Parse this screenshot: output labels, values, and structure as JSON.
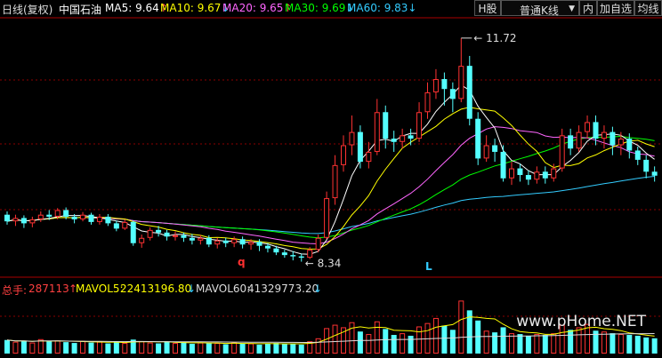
{
  "header": {
    "period": "日线(复权)",
    "stock_name": "中国石油",
    "ma": [
      {
        "label": "MA5: ",
        "value": "9.64",
        "arrow": "↑",
        "color": "#ffffff"
      },
      {
        "label": "MA10: ",
        "value": "9.67",
        "arrow": "↓",
        "color": "#ffff00"
      },
      {
        "label": "MA20: ",
        "value": "9.65",
        "arrow": "↑",
        "color": "#ff66ff"
      },
      {
        "label": "MA30: ",
        "value": "9.69",
        "arrow": "↓",
        "color": "#00ff00"
      },
      {
        "label": "MA60: ",
        "value": "9.83",
        "arrow": "↓",
        "color": "#33ccff"
      }
    ],
    "buttons": {
      "h_share": "H股",
      "kline_type": "普通K线",
      "kline_arrow": "▼",
      "inner": "内",
      "add_watch": "加自选",
      "ma_line": "均线"
    }
  },
  "annotations": {
    "high_label": "11.72",
    "low_label": "8.34",
    "mark_q": "q",
    "mark_L": "L"
  },
  "volume_header": {
    "total_label": "总手: ",
    "total_value": "287113",
    "total_arrow": "↑",
    "mavol5_label": "MAVOL5: ",
    "mavol5_value": "22413196.80",
    "mavol5_arrow": "↓",
    "mavol60_label": "MAVOL60: ",
    "mavol60_value": "41329773.20",
    "mavol60_arrow": "↓"
  },
  "watermark": "www.pHome.NET",
  "colors": {
    "up": "#ff3232",
    "down": "#54ffff",
    "ma5": "#ffffff",
    "ma10": "#ffff00",
    "ma20": "#ff66ff",
    "ma30": "#00ff00",
    "ma60": "#33ccff",
    "grid": "#8b0000"
  },
  "chart_data": {
    "type": "candlestick",
    "title": "中国石油",
    "price_range": [
      8.2,
      12.0
    ],
    "high": 11.72,
    "low": 8.34,
    "candles": [
      {
        "o": 9.05,
        "c": 8.95,
        "h": 9.1,
        "l": 8.9
      },
      {
        "o": 8.95,
        "c": 9.0,
        "h": 9.05,
        "l": 8.88
      },
      {
        "o": 9.0,
        "c": 8.92,
        "h": 9.04,
        "l": 8.85
      },
      {
        "o": 8.92,
        "c": 8.98,
        "h": 9.02,
        "l": 8.86
      },
      {
        "o": 8.98,
        "c": 9.05,
        "h": 9.1,
        "l": 8.94
      },
      {
        "o": 9.05,
        "c": 9.02,
        "h": 9.12,
        "l": 8.97
      },
      {
        "o": 9.02,
        "c": 9.12,
        "h": 9.15,
        "l": 8.98
      },
      {
        "o": 9.12,
        "c": 9.02,
        "h": 9.16,
        "l": 8.98
      },
      {
        "o": 9.02,
        "c": 8.98,
        "h": 9.06,
        "l": 8.92
      },
      {
        "o": 8.98,
        "c": 9.05,
        "h": 9.09,
        "l": 8.95
      },
      {
        "o": 9.05,
        "c": 8.94,
        "h": 9.08,
        "l": 8.9
      },
      {
        "o": 8.94,
        "c": 9.02,
        "h": 9.06,
        "l": 8.9
      },
      {
        "o": 9.02,
        "c": 8.92,
        "h": 9.06,
        "l": 8.88
      },
      {
        "o": 8.92,
        "c": 8.84,
        "h": 8.96,
        "l": 8.8
      },
      {
        "o": 8.84,
        "c": 8.94,
        "h": 8.98,
        "l": 8.82
      },
      {
        "o": 8.94,
        "c": 8.62,
        "h": 8.96,
        "l": 8.58
      },
      {
        "o": 8.62,
        "c": 8.7,
        "h": 8.75,
        "l": 8.55
      },
      {
        "o": 8.7,
        "c": 8.82,
        "h": 8.86,
        "l": 8.66
      },
      {
        "o": 8.82,
        "c": 8.78,
        "h": 8.88,
        "l": 8.72
      },
      {
        "o": 8.78,
        "c": 8.72,
        "h": 8.82,
        "l": 8.66
      },
      {
        "o": 8.72,
        "c": 8.74,
        "h": 8.8,
        "l": 8.66
      },
      {
        "o": 8.74,
        "c": 8.7,
        "h": 8.78,
        "l": 8.64
      },
      {
        "o": 8.7,
        "c": 8.66,
        "h": 8.76,
        "l": 8.6
      },
      {
        "o": 8.66,
        "c": 8.7,
        "h": 8.74,
        "l": 8.6
      },
      {
        "o": 8.7,
        "c": 8.6,
        "h": 8.74,
        "l": 8.56
      },
      {
        "o": 8.6,
        "c": 8.66,
        "h": 8.7,
        "l": 8.54
      },
      {
        "o": 8.66,
        "c": 8.62,
        "h": 8.7,
        "l": 8.56
      },
      {
        "o": 8.62,
        "c": 8.68,
        "h": 8.72,
        "l": 8.56
      },
      {
        "o": 8.68,
        "c": 8.6,
        "h": 8.72,
        "l": 8.54
      },
      {
        "o": 8.6,
        "c": 8.64,
        "h": 8.68,
        "l": 8.52
      },
      {
        "o": 8.64,
        "c": 8.58,
        "h": 8.68,
        "l": 8.5
      },
      {
        "o": 8.58,
        "c": 8.54,
        "h": 8.62,
        "l": 8.48
      },
      {
        "o": 8.54,
        "c": 8.48,
        "h": 8.58,
        "l": 8.44
      },
      {
        "o": 8.48,
        "c": 8.44,
        "h": 8.52,
        "l": 8.4
      },
      {
        "o": 8.44,
        "c": 8.42,
        "h": 8.5,
        "l": 8.36
      },
      {
        "o": 8.42,
        "c": 8.4,
        "h": 8.46,
        "l": 8.34
      },
      {
        "o": 8.4,
        "c": 8.52,
        "h": 8.56,
        "l": 8.38
      },
      {
        "o": 8.52,
        "c": 8.7,
        "h": 8.75,
        "l": 8.48
      },
      {
        "o": 8.7,
        "c": 9.3,
        "h": 9.4,
        "l": 8.68
      },
      {
        "o": 9.3,
        "c": 9.8,
        "h": 9.95,
        "l": 9.2
      },
      {
        "o": 9.8,
        "c": 10.1,
        "h": 10.25,
        "l": 9.7
      },
      {
        "o": 10.1,
        "c": 10.3,
        "h": 10.55,
        "l": 9.95
      },
      {
        "o": 10.3,
        "c": 9.85,
        "h": 10.4,
        "l": 9.75
      },
      {
        "o": 9.85,
        "c": 10.0,
        "h": 10.15,
        "l": 9.75
      },
      {
        "o": 10.0,
        "c": 10.6,
        "h": 10.8,
        "l": 9.95
      },
      {
        "o": 10.6,
        "c": 10.2,
        "h": 10.7,
        "l": 10.05
      },
      {
        "o": 10.2,
        "c": 10.15,
        "h": 10.32,
        "l": 10.0
      },
      {
        "o": 10.15,
        "c": 10.25,
        "h": 10.35,
        "l": 10.05
      },
      {
        "o": 10.25,
        "c": 10.2,
        "h": 10.35,
        "l": 10.1
      },
      {
        "o": 10.2,
        "c": 10.6,
        "h": 10.75,
        "l": 10.15
      },
      {
        "o": 10.6,
        "c": 10.9,
        "h": 11.05,
        "l": 10.5
      },
      {
        "o": 10.9,
        "c": 11.1,
        "h": 11.25,
        "l": 10.8
      },
      {
        "o": 11.1,
        "c": 10.95,
        "h": 11.2,
        "l": 10.7
      },
      {
        "o": 10.95,
        "c": 10.8,
        "h": 11.05,
        "l": 10.6
      },
      {
        "o": 10.8,
        "c": 11.3,
        "h": 11.72,
        "l": 10.75
      },
      {
        "o": 11.3,
        "c": 10.5,
        "h": 11.45,
        "l": 10.4
      },
      {
        "o": 10.5,
        "c": 9.9,
        "h": 10.6,
        "l": 9.8
      },
      {
        "o": 9.9,
        "c": 10.1,
        "h": 10.25,
        "l": 9.85
      },
      {
        "o": 10.1,
        "c": 10.0,
        "h": 10.2,
        "l": 9.85
      },
      {
        "o": 10.0,
        "c": 9.6,
        "h": 10.1,
        "l": 9.55
      },
      {
        "o": 9.6,
        "c": 9.75,
        "h": 9.85,
        "l": 9.5
      },
      {
        "o": 9.75,
        "c": 9.65,
        "h": 9.82,
        "l": 9.55
      },
      {
        "o": 9.65,
        "c": 9.58,
        "h": 9.72,
        "l": 9.5
      },
      {
        "o": 9.58,
        "c": 9.7,
        "h": 9.78,
        "l": 9.52
      },
      {
        "o": 9.7,
        "c": 9.6,
        "h": 9.78,
        "l": 9.52
      },
      {
        "o": 9.6,
        "c": 9.75,
        "h": 9.82,
        "l": 9.55
      },
      {
        "o": 9.75,
        "c": 10.25,
        "h": 10.35,
        "l": 9.7
      },
      {
        "o": 10.25,
        "c": 10.05,
        "h": 10.35,
        "l": 9.95
      },
      {
        "o": 10.05,
        "c": 10.3,
        "h": 10.4,
        "l": 10.0
      },
      {
        "o": 10.3,
        "c": 10.45,
        "h": 10.55,
        "l": 10.2
      },
      {
        "o": 10.45,
        "c": 10.2,
        "h": 10.55,
        "l": 10.1
      },
      {
        "o": 10.2,
        "c": 10.3,
        "h": 10.4,
        "l": 10.05
      },
      {
        "o": 10.3,
        "c": 10.1,
        "h": 10.38,
        "l": 9.95
      },
      {
        "o": 10.1,
        "c": 10.2,
        "h": 10.3,
        "l": 9.95
      },
      {
        "o": 10.2,
        "c": 10.02,
        "h": 10.28,
        "l": 9.9
      },
      {
        "o": 10.02,
        "c": 9.88,
        "h": 10.08,
        "l": 9.8
      },
      {
        "o": 9.88,
        "c": 9.7,
        "h": 9.95,
        "l": 9.6
      },
      {
        "o": 9.7,
        "c": 9.64,
        "h": 9.78,
        "l": 9.55
      }
    ],
    "volume": [
      3.2,
      2.8,
      3.0,
      2.6,
      3.4,
      2.9,
      3.1,
      2.7,
      2.5,
      3.0,
      2.6,
      2.8,
      2.4,
      2.7,
      2.5,
      3.3,
      2.9,
      2.6,
      2.4,
      2.8,
      2.5,
      2.7,
      2.3,
      2.6,
      2.4,
      2.5,
      2.2,
      2.6,
      2.3,
      2.4,
      2.1,
      2.3,
      2.5,
      2.2,
      2.4,
      2.1,
      2.9,
      3.6,
      6.0,
      6.8,
      6.2,
      7.4,
      5.2,
      4.6,
      7.6,
      5.8,
      4.4,
      4.8,
      4.2,
      6.4,
      7.2,
      8.4,
      6.6,
      5.6,
      12.5,
      10.2,
      7.8,
      5.4,
      5.0,
      6.2,
      4.8,
      4.6,
      4.2,
      4.6,
      4.4,
      4.8,
      6.8,
      5.6,
      6.2,
      7.0,
      5.4,
      5.2,
      4.8,
      4.6,
      4.4,
      4.2,
      3.8,
      3.6
    ],
    "volume_max": 13.0
  }
}
